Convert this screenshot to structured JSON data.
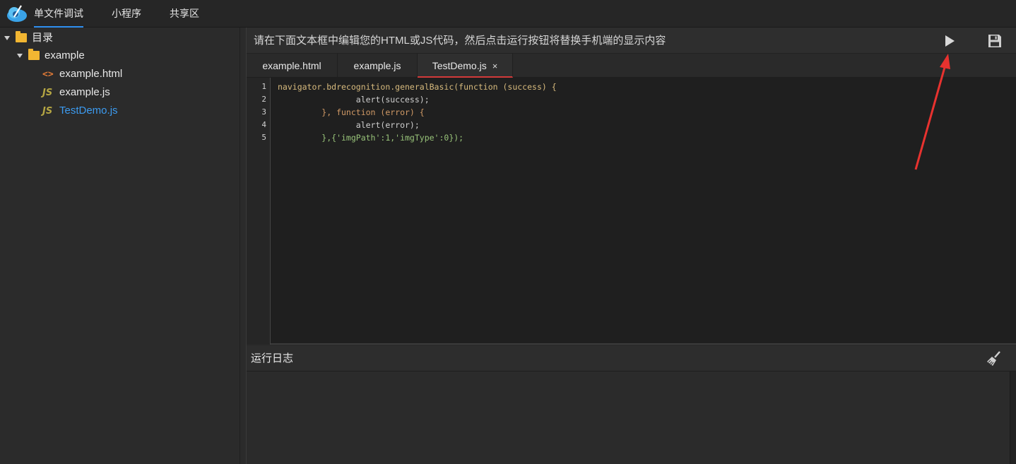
{
  "topnav": {
    "tabs": [
      {
        "label": "单文件调试",
        "active": true
      },
      {
        "label": "小程序",
        "active": false
      },
      {
        "label": "共享区",
        "active": false
      }
    ]
  },
  "sidebar": {
    "root": {
      "label": "目录",
      "icon": "folder-icon"
    },
    "folder": {
      "label": "example",
      "icon": "folder-icon"
    },
    "files": [
      {
        "label": "example.html",
        "icon": "html-icon",
        "selected": false
      },
      {
        "label": "example.js",
        "icon": "js-icon",
        "selected": false
      },
      {
        "label": "TestDemo.js",
        "icon": "js-icon",
        "selected": true
      }
    ]
  },
  "editor": {
    "hint": "请在下面文本框中编辑您的HTML或JS代码，然后点击运行按钮将替换手机端的显示内容",
    "run_icon": "play-icon",
    "save_icon": "save-icon",
    "tabs": [
      {
        "label": "example.html",
        "active": false
      },
      {
        "label": "example.js",
        "active": false
      },
      {
        "label": "TestDemo.js",
        "active": true,
        "close": "×"
      }
    ],
    "line_numbers": [
      "1",
      "2",
      "3",
      "4",
      "5"
    ],
    "code": [
      "navigator.bdrecognition.generalBasic(function (success) {",
      "                alert(success);",
      "         }, function (error) {",
      "                alert(error);",
      "         },{'imgPath':1,'imgType':0});"
    ]
  },
  "log": {
    "title": "运行日志",
    "clear_icon": "broom-icon"
  },
  "colors": {
    "accent_blue": "#2e8ff0",
    "active_tab_underline": "#d23a3a",
    "selected_file": "#3c9bf0",
    "arrow": "#e8322f"
  }
}
